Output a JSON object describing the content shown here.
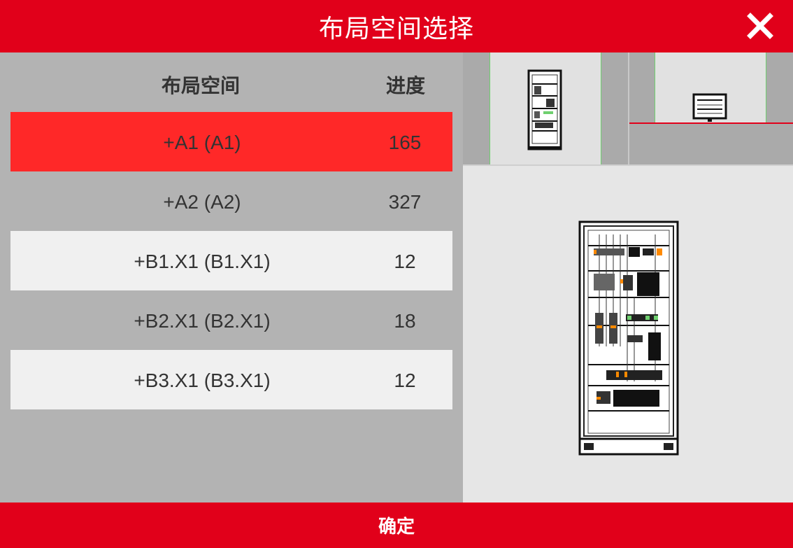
{
  "header": {
    "title": "布局空间选择"
  },
  "columns": {
    "name": "布局空间",
    "progress": "进度"
  },
  "rows": [
    {
      "name": "+A1 (A1)",
      "progress": "165"
    },
    {
      "name": "+A2 (A2)",
      "progress": "327"
    },
    {
      "name": "+B1.X1 (B1.X1)",
      "progress": "12"
    },
    {
      "name": "+B2.X1 (B2.X1)",
      "progress": "18"
    },
    {
      "name": "+B3.X1 (B3.X1)",
      "progress": "12"
    }
  ],
  "selected_row": "+A1 (A1)",
  "footer": {
    "confirm_label": "确定"
  },
  "colors": {
    "brand_red": "#e1001a",
    "selected_row": "#ff2828",
    "thumb_border": "#6fd06f"
  }
}
